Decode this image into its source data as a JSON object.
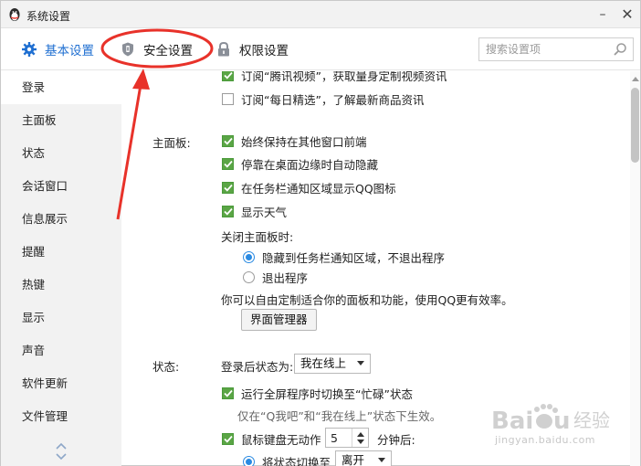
{
  "window": {
    "title": "系统设置"
  },
  "tabs": [
    {
      "label": "基本设置",
      "icon": "gear-icon"
    },
    {
      "label": "安全设置",
      "icon": "shield-icon"
    },
    {
      "label": "权限设置",
      "icon": "lock-icon"
    }
  ],
  "search": {
    "placeholder": "搜索设置项"
  },
  "sidebar": {
    "items": [
      {
        "label": "登录"
      },
      {
        "label": "主面板"
      },
      {
        "label": "状态"
      },
      {
        "label": "会话窗口"
      },
      {
        "label": "信息展示"
      },
      {
        "label": "提醒"
      },
      {
        "label": "热键"
      },
      {
        "label": "显示"
      },
      {
        "label": "声音"
      },
      {
        "label": "软件更新"
      },
      {
        "label": "文件管理"
      }
    ]
  },
  "login": {
    "sub_tencent_video": {
      "label": "订阅“腾讯视频”，获取量身定制视频资讯",
      "checked": true
    },
    "sub_daily_pick": {
      "label": "订阅“每日精选”，了解最新商品资讯",
      "checked": false
    }
  },
  "main_panel": {
    "section_label": "主面板:",
    "options": [
      {
        "label": "始终保持在其他窗口前端",
        "checked": true
      },
      {
        "label": "停靠在桌面边缘时自动隐藏",
        "checked": true
      },
      {
        "label": "在任务栏通知区域显示QQ图标",
        "checked": true
      },
      {
        "label": "显示天气",
        "checked": true
      }
    ],
    "close_label": "关闭主面板时:",
    "close_options": [
      {
        "label": "隐藏到任务栏通知区域，不退出程序",
        "selected": true
      },
      {
        "label": "退出程序",
        "selected": false
      }
    ],
    "customize_text": "你可以自由定制适合你的面板和功能，使用QQ更有效率。",
    "manager_button": "界面管理器"
  },
  "status": {
    "section_label": "状态:",
    "after_login_label": "登录后状态为:",
    "after_login_value": "我在线上",
    "fullscreen_busy": {
      "label": "运行全屏程序时切换至“忙碌”状态",
      "checked": true
    },
    "fullscreen_note": "仅在“Q我吧”和“我在线上”状态下生效。",
    "idle": {
      "label": "鼠标键盘无动作",
      "checked": true,
      "minutes": "5",
      "unit": "分钟后:"
    },
    "switch_to": {
      "label": "将状态切换至",
      "value": "离开",
      "selected": true
    }
  },
  "watermark": {
    "brand": "Baidu经验",
    "url": "jingyan.baidu.com"
  },
  "colors": {
    "accent": "#1f6fd1",
    "annotation": "#e8322a",
    "check": "#5aa545",
    "radio": "#2a8ae2"
  }
}
